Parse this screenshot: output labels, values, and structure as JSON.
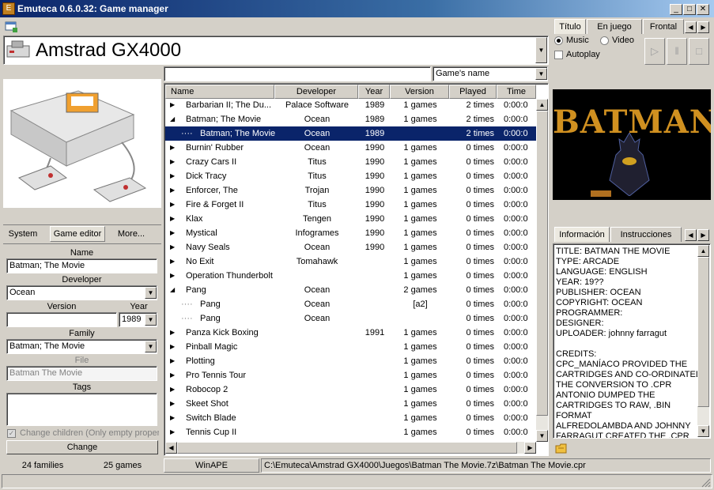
{
  "window": {
    "title": "Emuteca 0.6.0.32: Game manager",
    "min": "_",
    "max": "□",
    "close": "✕"
  },
  "system": {
    "name": "Amstrad GX4000"
  },
  "left_tabs": [
    "System",
    "Game editor",
    "More..."
  ],
  "editor": {
    "name_label": "Name",
    "name_value": "Batman; The Movie",
    "developer_label": "Developer",
    "developer_value": "Ocean",
    "version_label": "Version",
    "year_label": "Year",
    "version_value": "",
    "year_value": "1989",
    "family_label": "Family",
    "family_value": "Batman; The Movie",
    "file_label": "File",
    "file_value": "Batman The Movie",
    "tags_label": "Tags",
    "change_children": "Change children (Only empty proper",
    "change_button": "Change"
  },
  "search": {
    "value": "",
    "filter": "Game's name"
  },
  "columns": [
    "Name",
    "Developer",
    "Year",
    "Version",
    "Played",
    "Time"
  ],
  "rows": [
    {
      "exp": "▶",
      "name": "Barbarian II; The Du...",
      "dev": "Palace Software",
      "year": "1989",
      "ver": "1 games",
      "played": "2 times",
      "time": "0:00:0",
      "level": 0
    },
    {
      "exp": "◢",
      "name": "Batman; The Movie",
      "dev": "Ocean",
      "year": "1989",
      "ver": "1 games",
      "played": "2 times",
      "time": "0:00:0",
      "level": 0
    },
    {
      "exp": "",
      "name": "Batman; The Movie",
      "dev": "Ocean",
      "year": "1989",
      "ver": "",
      "played": "2 times",
      "time": "0:00:0",
      "level": 1,
      "selected": true
    },
    {
      "exp": "▶",
      "name": "Burnin' Rubber",
      "dev": "Ocean",
      "year": "1990",
      "ver": "1 games",
      "played": "0 times",
      "time": "0:00:0",
      "level": 0
    },
    {
      "exp": "▶",
      "name": "Crazy Cars II",
      "dev": "Titus",
      "year": "1990",
      "ver": "1 games",
      "played": "0 times",
      "time": "0:00:0",
      "level": 0
    },
    {
      "exp": "▶",
      "name": "Dick Tracy",
      "dev": "Titus",
      "year": "1990",
      "ver": "1 games",
      "played": "0 times",
      "time": "0:00:0",
      "level": 0
    },
    {
      "exp": "▶",
      "name": "Enforcer, The",
      "dev": "Trojan",
      "year": "1990",
      "ver": "1 games",
      "played": "0 times",
      "time": "0:00:0",
      "level": 0
    },
    {
      "exp": "▶",
      "name": "Fire & Forget II",
      "dev": "Titus",
      "year": "1990",
      "ver": "1 games",
      "played": "0 times",
      "time": "0:00:0",
      "level": 0
    },
    {
      "exp": "▶",
      "name": "Klax",
      "dev": "Tengen",
      "year": "1990",
      "ver": "1 games",
      "played": "0 times",
      "time": "0:00:0",
      "level": 0
    },
    {
      "exp": "▶",
      "name": "Mystical",
      "dev": "Infogrames",
      "year": "1990",
      "ver": "1 games",
      "played": "0 times",
      "time": "0:00:0",
      "level": 0
    },
    {
      "exp": "▶",
      "name": "Navy Seals",
      "dev": "Ocean",
      "year": "1990",
      "ver": "1 games",
      "played": "0 times",
      "time": "0:00:0",
      "level": 0
    },
    {
      "exp": "▶",
      "name": "No Exit",
      "dev": "Tomahawk",
      "year": "",
      "ver": "1 games",
      "played": "0 times",
      "time": "0:00:0",
      "level": 0
    },
    {
      "exp": "▶",
      "name": "Operation Thunderbolt",
      "dev": "",
      "year": "",
      "ver": "1 games",
      "played": "0 times",
      "time": "0:00:0",
      "level": 0
    },
    {
      "exp": "◢",
      "name": "Pang",
      "dev": "Ocean",
      "year": "",
      "ver": "2 games",
      "played": "0 times",
      "time": "0:00:0",
      "level": 0
    },
    {
      "exp": "",
      "name": "Pang",
      "dev": "Ocean",
      "year": "",
      "ver": "[a2]",
      "played": "0 times",
      "time": "0:00:0",
      "level": 1
    },
    {
      "exp": "",
      "name": "Pang",
      "dev": "Ocean",
      "year": "",
      "ver": "",
      "played": "0 times",
      "time": "0:00:0",
      "level": 1
    },
    {
      "exp": "▶",
      "name": "Panza Kick Boxing",
      "dev": "",
      "year": "1991",
      "ver": "1 games",
      "played": "0 times",
      "time": "0:00:0",
      "level": 0
    },
    {
      "exp": "▶",
      "name": "Pinball Magic",
      "dev": "",
      "year": "",
      "ver": "1 games",
      "played": "0 times",
      "time": "0:00:0",
      "level": 0
    },
    {
      "exp": "▶",
      "name": "Plotting",
      "dev": "",
      "year": "",
      "ver": "1 games",
      "played": "0 times",
      "time": "0:00:0",
      "level": 0
    },
    {
      "exp": "▶",
      "name": "Pro Tennis Tour",
      "dev": "",
      "year": "",
      "ver": "1 games",
      "played": "0 times",
      "time": "0:00:0",
      "level": 0
    },
    {
      "exp": "▶",
      "name": "Robocop 2",
      "dev": "",
      "year": "",
      "ver": "1 games",
      "played": "0 times",
      "time": "0:00:0",
      "level": 0
    },
    {
      "exp": "▶",
      "name": "Skeet Shot",
      "dev": "",
      "year": "",
      "ver": "1 games",
      "played": "0 times",
      "time": "0:00:0",
      "level": 0
    },
    {
      "exp": "▶",
      "name": "Switch Blade",
      "dev": "",
      "year": "",
      "ver": "1 games",
      "played": "0 times",
      "time": "0:00:0",
      "level": 0
    },
    {
      "exp": "▶",
      "name": "Tennis Cup II",
      "dev": "",
      "year": "",
      "ver": "1 games",
      "played": "0 times",
      "time": "0:00:0",
      "level": 0
    }
  ],
  "media_tabs": [
    "Título",
    "En juego",
    "Frontal"
  ],
  "media": {
    "music": "Music",
    "video": "Video",
    "autoplay": "Autoplay"
  },
  "screenshot": {
    "logo_text": "BATMAN"
  },
  "info_tabs": [
    "Información",
    "Instrucciones"
  ],
  "info_lines": [
    "TITLE: BATMAN THE MOVIE",
    "TYPE: ARCADE",
    "LANGUAGE: ENGLISH",
    "YEAR: 19??",
    "PUBLISHER: OCEAN",
    "COPYRIGHT: OCEAN",
    "PROGRAMMER:",
    "DESIGNER:",
    "UPLOADER: johnny farragut",
    "",
    "CREDITS:",
    "CPC_MANÍACO PROVIDED THE",
    "CARTRIDGES AND CO-ORDINATED",
    "THE CONVERSION TO .CPR",
    "ANTONIO DUMPED THE",
    "CARTRIDGES TO RAW, .BIN",
    "FORMAT",
    "ALFREDOLAMBDA AND JOHNNY",
    "FARRAGUT CREATED THE .CPR"
  ],
  "status": {
    "families": "24 families",
    "games": "25 games",
    "emulator": "WinAPE",
    "path": "C:\\Emuteca\\Amstrad GX4000\\Juegos\\Batman The Movie.7z\\Batman The Movie.cpr"
  }
}
